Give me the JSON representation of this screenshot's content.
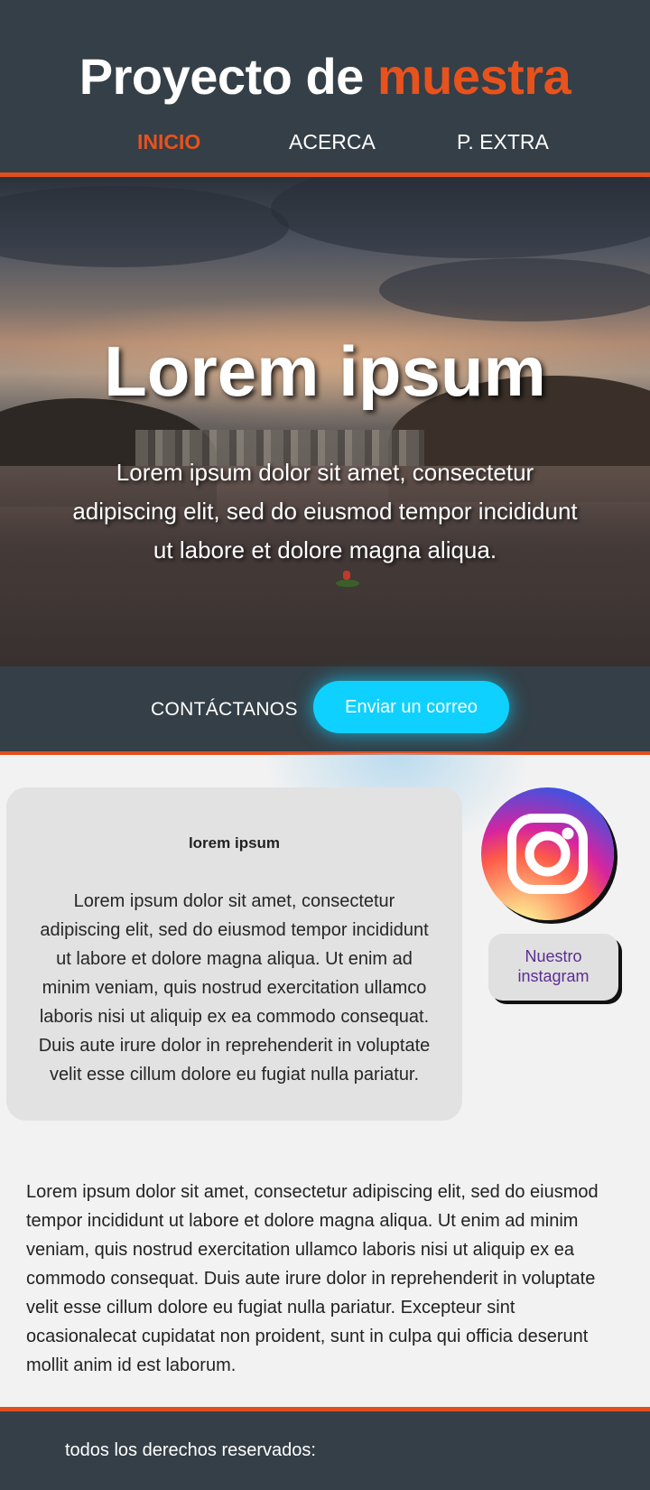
{
  "header": {
    "title_main": "Proyecto de",
    "title_accent": "muestra",
    "accent_color": "#e8521d",
    "background_color": "#343f47",
    "nav": [
      {
        "label": "INICIO",
        "active": true
      },
      {
        "label": "ACERCA",
        "active": false
      },
      {
        "label": "P. EXTRA",
        "active": false
      }
    ]
  },
  "hero": {
    "title": "Lorem ipsum",
    "text": "Lorem ipsum dolor sit amet, consectetur adipiscing elit, sed do eiusmod tempor incididunt ut labore et dolore magna aliqua."
  },
  "contact": {
    "label": "CONTÁCTANOS",
    "button_label": "Enviar un correo",
    "button_color": "#0fd1ff"
  },
  "card": {
    "title": "lorem ipsum",
    "text": "Lorem ipsum dolor sit amet, consectetur adipiscing elit, sed do eiusmod tempor incididunt ut labore et dolore magna aliqua. Ut enim ad minim veniam, quis nostrud exercitation ullamco laboris nisi ut aliquip ex ea commodo consequat. Duis aute irure dolor in reprehenderit in voluptate velit esse cillum dolore eu fugiat nulla pariatur."
  },
  "instagram": {
    "icon": "instagram-icon",
    "button_label_line1": "Nuestro",
    "button_label_line2": "instagram"
  },
  "main_text": "Lorem ipsum dolor sit amet, consectetur adipiscing elit, sed do eiusmod tempor incididunt ut labore et dolore magna aliqua. Ut enim ad minim veniam, quis nostrud exercitation ullamco laboris nisi ut aliquip ex ea commodo consequat. Duis aute irure dolor in reprehenderit in voluptate velit esse cillum dolore eu fugiat nulla pariatur. Excepteur sint ocasionalecat cupidatat non proident, sunt in culpa qui officia deserunt mollit anim id est laborum.",
  "footer": {
    "text": "todos los derechos reservados:"
  }
}
